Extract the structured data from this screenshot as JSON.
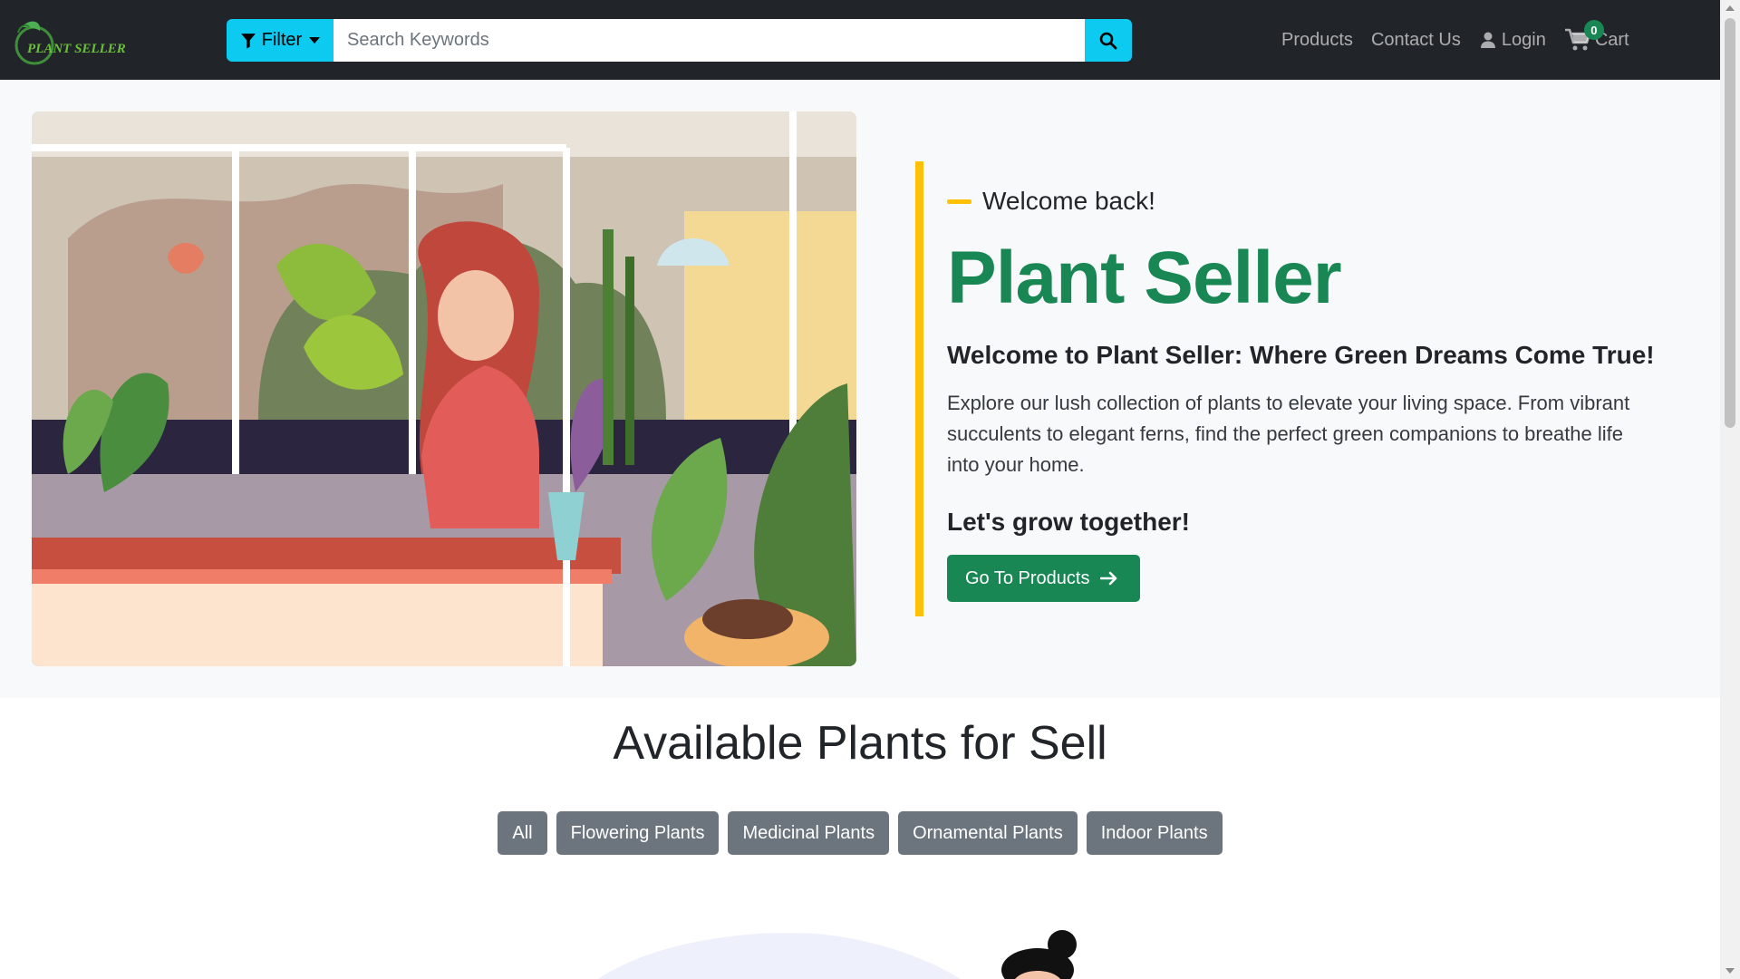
{
  "navbar": {
    "brand_text": "PLANT SELLER",
    "filter_label": "Filter",
    "search_placeholder": "Search Keywords",
    "links": {
      "products": "Products",
      "contact": "Contact Us",
      "login": "Login",
      "cart": "Cart"
    },
    "cart_count": "0"
  },
  "hero": {
    "welcome": "Welcome back!",
    "title": "Plant Seller",
    "subtitle": "Welcome to Plant Seller: Where Green Dreams Come True!",
    "description": "Explore our lush collection of plants to elevate your living space. From vibrant succulents to elegant ferns, find the perfect green companions to breathe life into your home.",
    "tagline": "Let's grow together!",
    "cta_label": "Go To Products"
  },
  "products_section": {
    "title": "Available Plants for Sell",
    "categories": [
      "All",
      "Flowering Plants",
      "Medicinal Plants",
      "Ornamental Plants",
      "Indoor Plants"
    ]
  },
  "colors": {
    "navbar": "#212529",
    "accent_cyan": "#0dcaf0",
    "brand_green": "#198754",
    "accent_yellow": "#ffc107",
    "category_gray": "#6c757d"
  },
  "icons": {
    "filter": "filter-icon",
    "search": "search-icon",
    "login": "user-icon",
    "cart": "cart-icon",
    "cta": "arrow-right-icon"
  }
}
